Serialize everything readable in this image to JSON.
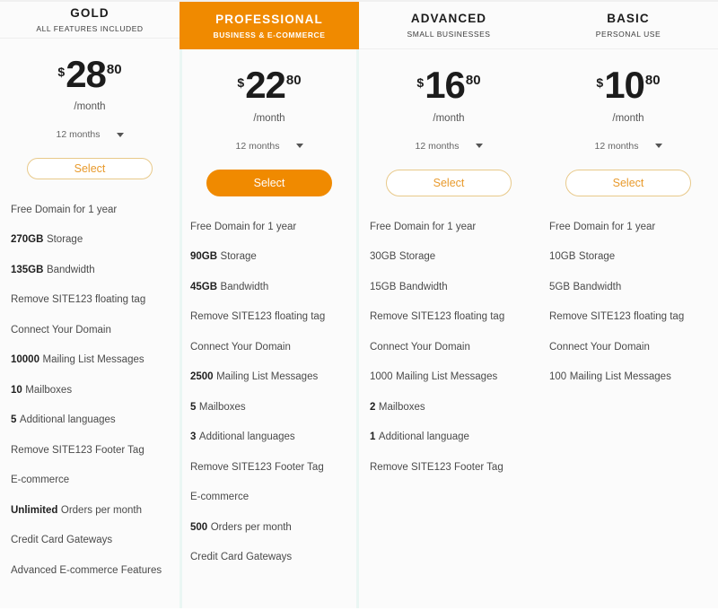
{
  "meta": {
    "accent_color": "#f08a00",
    "select_border_color": "#e8c98a",
    "select_text_color": "#e89a2c",
    "featured_tint": "#eaf6f3",
    "card_background": "#fbfbfb"
  },
  "plans": [
    {
      "name": "GOLD",
      "tagline": "ALL FEATURES INCLUDED",
      "featured": false,
      "currency": "$",
      "price": "28",
      "cents": "80",
      "per": "/month",
      "term": "12 months",
      "select_label": "Select",
      "features": [
        {
          "prefix": "",
          "bold": false,
          "text": "Free Domain for 1 year"
        },
        {
          "prefix": "270GB",
          "bold": true,
          "text": "Storage"
        },
        {
          "prefix": "135GB",
          "bold": true,
          "text": "Bandwidth"
        },
        {
          "prefix": "",
          "bold": false,
          "text": "Remove SITE123 floating tag"
        },
        {
          "prefix": "",
          "bold": false,
          "text": "Connect Your Domain"
        },
        {
          "prefix": "10000",
          "bold": true,
          "text": "Mailing List Messages"
        },
        {
          "prefix": "10",
          "bold": true,
          "text": "Mailboxes"
        },
        {
          "prefix": "5",
          "bold": true,
          "text": "Additional languages"
        },
        {
          "prefix": "",
          "bold": false,
          "text": "Remove SITE123 Footer Tag"
        },
        {
          "prefix": "",
          "bold": false,
          "text": "E-commerce"
        },
        {
          "prefix": "Unlimited",
          "bold": true,
          "text": "Orders per month"
        },
        {
          "prefix": "",
          "bold": false,
          "text": "Credit Card Gateways"
        },
        {
          "prefix": "",
          "bold": false,
          "text": "Advanced E-commerce Features"
        }
      ]
    },
    {
      "name": "PROFESSIONAL",
      "tagline": "BUSINESS & E-COMMERCE",
      "featured": true,
      "currency": "$",
      "price": "22",
      "cents": "80",
      "per": "/month",
      "term": "12 months",
      "select_label": "Select",
      "features": [
        {
          "prefix": "",
          "bold": false,
          "text": "Free Domain for 1 year"
        },
        {
          "prefix": "90GB",
          "bold": true,
          "text": "Storage"
        },
        {
          "prefix": "45GB",
          "bold": true,
          "text": "Bandwidth"
        },
        {
          "prefix": "",
          "bold": false,
          "text": "Remove SITE123 floating tag"
        },
        {
          "prefix": "",
          "bold": false,
          "text": "Connect Your Domain"
        },
        {
          "prefix": "2500",
          "bold": true,
          "text": "Mailing List Messages"
        },
        {
          "prefix": "5",
          "bold": true,
          "text": "Mailboxes"
        },
        {
          "prefix": "3",
          "bold": true,
          "text": "Additional languages"
        },
        {
          "prefix": "",
          "bold": false,
          "text": "Remove SITE123 Footer Tag"
        },
        {
          "prefix": "",
          "bold": false,
          "text": "E-commerce"
        },
        {
          "prefix": "500",
          "bold": true,
          "text": "Orders per month"
        },
        {
          "prefix": "",
          "bold": false,
          "text": "Credit Card Gateways"
        }
      ]
    },
    {
      "name": "ADVANCED",
      "tagline": "SMALL BUSINESSES",
      "featured": false,
      "currency": "$",
      "price": "16",
      "cents": "80",
      "per": "/month",
      "term": "12 months",
      "select_label": "Select",
      "features": [
        {
          "prefix": "",
          "bold": false,
          "text": "Free Domain for 1 year"
        },
        {
          "prefix": "30GB",
          "bold": false,
          "text": "Storage"
        },
        {
          "prefix": "15GB",
          "bold": false,
          "text": "Bandwidth"
        },
        {
          "prefix": "",
          "bold": false,
          "text": "Remove SITE123 floating tag"
        },
        {
          "prefix": "",
          "bold": false,
          "text": "Connect Your Domain"
        },
        {
          "prefix": "1000",
          "bold": false,
          "text": "Mailing List Messages"
        },
        {
          "prefix": "2",
          "bold": true,
          "text": "Mailboxes"
        },
        {
          "prefix": "1",
          "bold": true,
          "text": "Additional language"
        },
        {
          "prefix": "",
          "bold": false,
          "text": "Remove SITE123 Footer Tag"
        }
      ]
    },
    {
      "name": "BASIC",
      "tagline": "PERSONAL USE",
      "featured": false,
      "currency": "$",
      "price": "10",
      "cents": "80",
      "per": "/month",
      "term": "12 months",
      "select_label": "Select",
      "features": [
        {
          "prefix": "",
          "bold": false,
          "text": "Free Domain for 1 year"
        },
        {
          "prefix": "10GB",
          "bold": false,
          "text": "Storage"
        },
        {
          "prefix": "5GB",
          "bold": false,
          "text": "Bandwidth"
        },
        {
          "prefix": "",
          "bold": false,
          "text": "Remove SITE123 floating tag"
        },
        {
          "prefix": "",
          "bold": false,
          "text": "Connect Your Domain"
        },
        {
          "prefix": "100",
          "bold": false,
          "text": "Mailing List Messages"
        }
      ]
    }
  ]
}
